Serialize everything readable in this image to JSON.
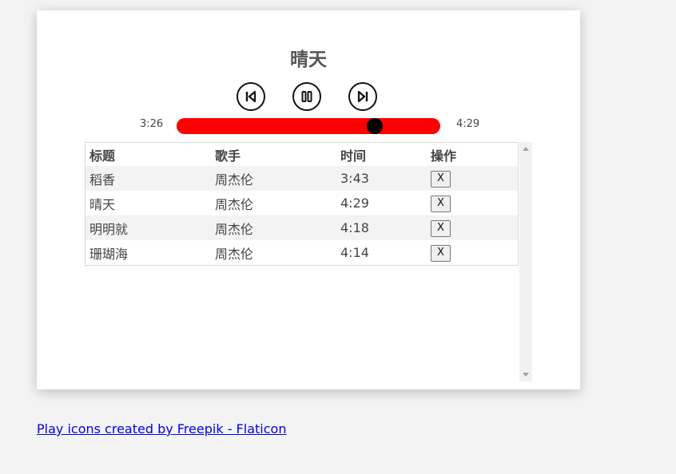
{
  "player": {
    "song_title": "晴天",
    "current_time": "3:26",
    "total_time": "4:29",
    "progress": 0.75,
    "accent_color": "#ff0000",
    "controls": {
      "prev_icon": "skip-previous-icon",
      "pause_icon": "pause-icon",
      "next_icon": "skip-next-icon"
    }
  },
  "playlist": {
    "headers": [
      "标题",
      "歌手",
      "时间",
      "操作"
    ],
    "rows": [
      {
        "title": "稻香",
        "artist": "周杰伦",
        "duration": "3:43",
        "action": "X"
      },
      {
        "title": "晴天",
        "artist": "周杰伦",
        "duration": "4:29",
        "action": "X"
      },
      {
        "title": "明明就",
        "artist": "周杰伦",
        "duration": "4:18",
        "action": "X"
      },
      {
        "title": "珊瑚海",
        "artist": "周杰伦",
        "duration": "4:14",
        "action": "X"
      }
    ]
  },
  "footer": {
    "credit_link": "Play icons created by Freepik - Flaticon"
  }
}
